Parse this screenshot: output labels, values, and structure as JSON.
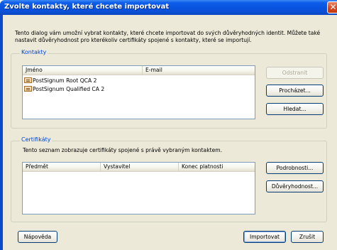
{
  "window": {
    "title": "Zvolte kontakty, které chcete importovat",
    "close_glyph": "✕"
  },
  "intro_text": "Tento dialog vám umožní vybrat kontakty, které chcete importovat do svých důvěryhodných identit. Můžete také nastavit důvěryhodnost pro kterékoliv certifikáty spojené s kontakty, které se importují.",
  "contacts": {
    "group_label": "Kontakty",
    "columns": [
      "Jméno",
      "E-mail"
    ],
    "rows": [
      {
        "name": "PostSignum Root QCA 2",
        "email": "",
        "icon": "certificate-icon"
      },
      {
        "name": "PostSignum Qualified CA 2",
        "email": "",
        "icon": "certificate-icon"
      }
    ],
    "buttons": {
      "remove": "Odstranit",
      "browse": "Procházet...",
      "search": "Hledat..."
    }
  },
  "certificates": {
    "group_label": "Certifikáty",
    "description": "Tento seznam zobrazuje certifikáty spojené s právě vybraným kontaktem.",
    "columns": [
      "Předmět",
      "Vystavitel",
      "Konec platnosti"
    ],
    "rows": [],
    "buttons": {
      "details": "Podrobnosti...",
      "trust": "Důvěryhodnost..."
    }
  },
  "footer": {
    "help": "Nápověda",
    "import": "Importovat",
    "cancel": "Zrušit"
  },
  "colors": {
    "titlebar": "#0854e0",
    "dialog_bg": "#ece9d8",
    "group_label": "#0046d5",
    "close_button": "#d6471f"
  }
}
